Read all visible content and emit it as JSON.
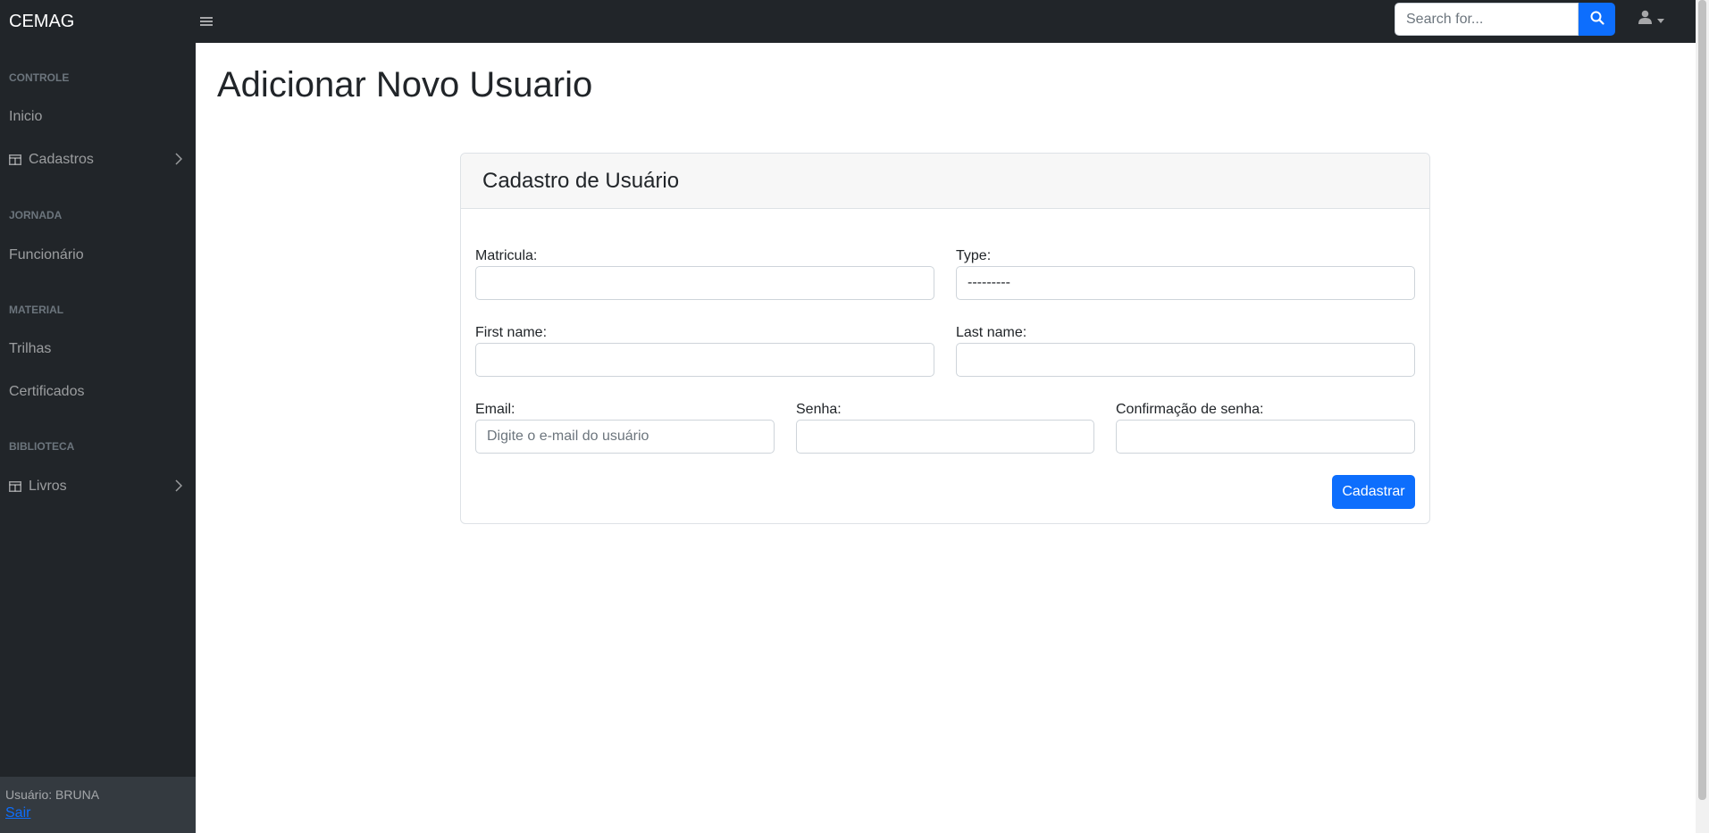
{
  "topbar": {
    "brand": "CEMAG",
    "search_placeholder": "Search for..."
  },
  "sidebar": {
    "sections": [
      {
        "heading": "CONTROLE"
      },
      {
        "heading": "JORNADA"
      },
      {
        "heading": "MATERIAL"
      },
      {
        "heading": "BIBLIOTECA"
      }
    ],
    "items": [
      {
        "label": "Inicio"
      },
      {
        "label": "Cadastros"
      },
      {
        "label": "Funcionário"
      },
      {
        "label": "Trilhas"
      },
      {
        "label": "Certificados"
      },
      {
        "label": "Livros"
      }
    ],
    "footer": {
      "user_text": "Usuário: BRUNA",
      "logout_label": "Sair"
    }
  },
  "main": {
    "page_title": "Adicionar Novo Usuario",
    "card_title": "Cadastro de Usuário",
    "form": {
      "matricula_label": "Matricula:",
      "type_label": "Type:",
      "type_value": "---------",
      "first_name_label": "First name:",
      "last_name_label": "Last name:",
      "email_label": "Email:",
      "email_placeholder": "Digite o e-mail do usuário",
      "senha_label": "Senha:",
      "confirm_label": "Confirmação de senha:",
      "submit_label": "Cadastrar"
    }
  },
  "colors": {
    "dark": "#212529",
    "primary": "#0d6efd",
    "sidebar_footer": "#343a40"
  }
}
